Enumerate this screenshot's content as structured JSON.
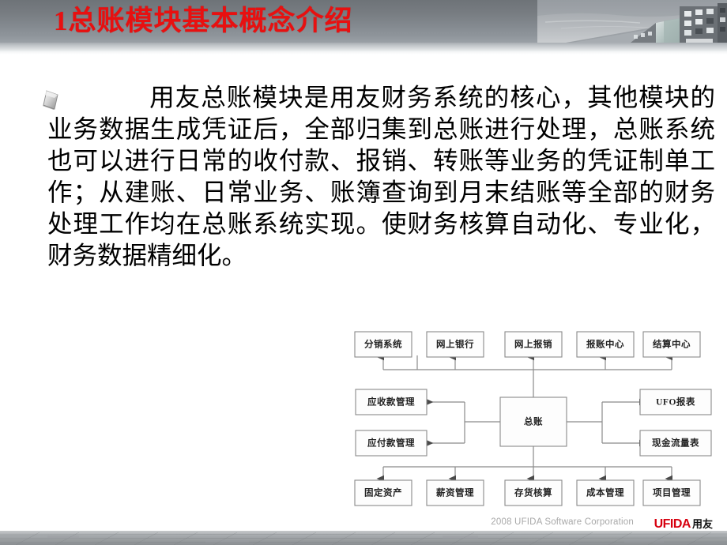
{
  "slide": {
    "title": "1总账模块基本概念介绍",
    "title_color": "#e81010",
    "header_bg_color": "#7d8288",
    "bullet_icon": "rhombus-bullet-icon",
    "body_indent": " ",
    "body_text": "用友总账模块是用友财务系统的核心，其他模块的业务数据生成凭证后，全部归集到总账进行处理，总账系统也可以进行日常的收付款、报销、转账等业务的凭证制单工作；从建账、日常业务、账簿查询到月末结账等全部的财务处理工作均在总账系统实现。使财务核算自动化、专业化，财务数据精细化。"
  },
  "diagram": {
    "center": "总账",
    "top_row": [
      "分销系统",
      "网上银行",
      "网上报销",
      "报账中心",
      "结算中心"
    ],
    "left_column": [
      "应收款管理",
      "应付款管理"
    ],
    "right_column": [
      "UFO报表",
      "现金流量表"
    ],
    "bottom_row": [
      "固定资产",
      "薪资管理",
      "存货核算",
      "成本管理",
      "项目管理"
    ],
    "box_fill": "#fdfdfd",
    "box_stroke": "#8a8a8a"
  },
  "footer": {
    "copyright": "2008 UFIDA Software Corporation",
    "brand": "UFIDA",
    "brand_cn": "用友",
    "brand_color": "#d7000f"
  }
}
